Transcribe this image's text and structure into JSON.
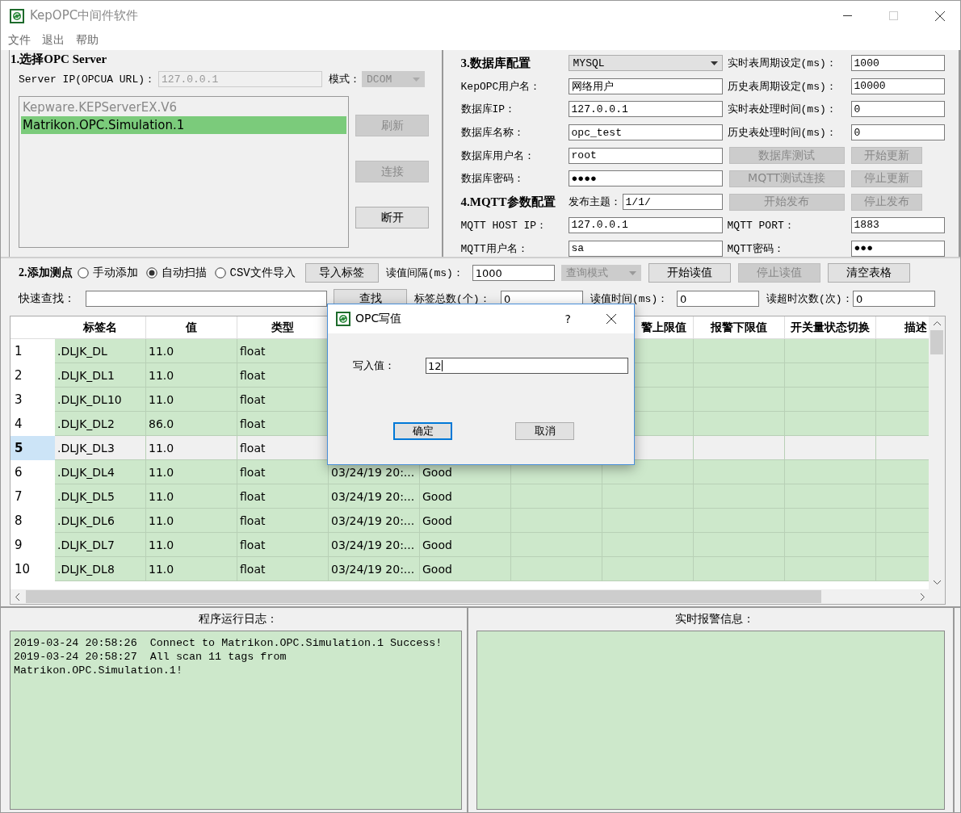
{
  "window": {
    "title": "KepOPC中间件软件"
  },
  "menu": [
    "文件",
    "退出",
    "帮助"
  ],
  "opc_server": {
    "heading": "1.选择OPC Server",
    "ip_label": "Server IP(OPCUA URL)：",
    "ip_value": "127.0.0.1",
    "ip_disabled": true,
    "mode_label": "模式：",
    "mode_value": "DCOM",
    "mode_disabled": true,
    "servers": [
      {
        "name": "Kepware.KEPServerEX.V6",
        "selected": false
      },
      {
        "name": "Matrikon.OPC.Simulation.1",
        "selected": true
      }
    ],
    "buttons": [
      {
        "label": "刷新",
        "disabled": true
      },
      {
        "label": "连接",
        "disabled": true
      },
      {
        "label": "断开",
        "disabled": false
      }
    ]
  },
  "config_rows": [
    {
      "cells": [
        {
          "kind": "heading",
          "text": "3.数据库配置"
        },
        {
          "kind": "select",
          "value": "MYSQL"
        },
        {
          "kind": "label",
          "text": "实时表周期设定(ms)："
        },
        {
          "kind": "field",
          "value": "1000"
        }
      ]
    },
    {
      "cells": [
        {
          "kind": "label",
          "text": "KepOPC用户名："
        },
        {
          "kind": "field",
          "value": "网络用户"
        },
        {
          "kind": "label",
          "text": "历史表周期设定(ms)："
        },
        {
          "kind": "field",
          "value": "10000"
        }
      ]
    },
    {
      "cells": [
        {
          "kind": "label",
          "text": "数据库IP："
        },
        {
          "kind": "field",
          "value": "127.0.0.1"
        },
        {
          "kind": "label",
          "text": "实时表处理时间(ms)："
        },
        {
          "kind": "field",
          "value": "0"
        }
      ]
    },
    {
      "cells": [
        {
          "kind": "label",
          "text": "数据库名称："
        },
        {
          "kind": "field",
          "value": "opc_test"
        },
        {
          "kind": "label",
          "text": "历史表处理时间(ms)："
        },
        {
          "kind": "field",
          "value": "0"
        }
      ]
    },
    {
      "cells": [
        {
          "kind": "label",
          "text": "数据库用户名："
        },
        {
          "kind": "field",
          "value": "root"
        },
        {
          "kind": "button",
          "text": "数据库测试",
          "disabled": true
        },
        {
          "kind": "button",
          "text": "开始更新",
          "disabled": true
        }
      ]
    },
    {
      "cells": [
        {
          "kind": "label",
          "text": "数据库密码："
        },
        {
          "kind": "field",
          "value": "●●●●"
        },
        {
          "kind": "button",
          "text": "MQTT测试连接",
          "disabled": true
        },
        {
          "kind": "button",
          "text": "停止更新",
          "disabled": true
        }
      ]
    },
    {
      "cells": [
        {
          "kind": "heading",
          "text": "4.MQTT参数配置"
        },
        {
          "kind": "labeled_field",
          "label": "发布主题：",
          "value": "1/1/"
        },
        {
          "kind": "button",
          "text": "开始发布",
          "disabled": true
        },
        {
          "kind": "button",
          "text": "停止发布",
          "disabled": true
        }
      ]
    },
    {
      "cells": [
        {
          "kind": "label",
          "text": "MQTT HOST IP："
        },
        {
          "kind": "field",
          "value": "127.0.0.1"
        },
        {
          "kind": "label",
          "text": "MQTT PORT："
        },
        {
          "kind": "field",
          "value": "1883"
        }
      ]
    },
    {
      "cells": [
        {
          "kind": "label",
          "text": "MQTT用户名："
        },
        {
          "kind": "field",
          "value": "sa"
        },
        {
          "kind": "label",
          "text": "MQTT密码："
        },
        {
          "kind": "field",
          "value": "●●●"
        }
      ]
    }
  ],
  "points": {
    "heading": "2.添加测点",
    "modes": [
      {
        "label": "手动添加",
        "selected": false
      },
      {
        "label": "自动扫描",
        "selected": true
      },
      {
        "label": "CSV文件导入",
        "selected": false
      }
    ],
    "import_button": "导入标签",
    "interval_label": "读值间隔(ms)：",
    "interval_value": "1000",
    "query_mode": {
      "value": "查询模式",
      "disabled": true
    },
    "buttons": [
      {
        "label": "开始读值",
        "disabled": false
      },
      {
        "label": "停止读值",
        "disabled": true
      },
      {
        "label": "清空表格",
        "disabled": false
      }
    ],
    "search_label": "快速查找：",
    "search_button": "查找",
    "stats": [
      {
        "label": "标签总数(个)：",
        "value": "0"
      },
      {
        "label": "读值时间(ms)：",
        "value": "0"
      },
      {
        "label": "读超时次数(次)：",
        "value": "0"
      }
    ]
  },
  "table": {
    "columns": [
      "标签名",
      "值",
      "类型",
      null,
      null,
      null,
      "警上限值",
      "报警下限值",
      "开关量状态切换",
      "描述"
    ],
    "rows": [
      {
        "index": "1",
        "cells": [
          ".DLJK_DL",
          "11.0",
          "float"
        ],
        "selected": false
      },
      {
        "index": "2",
        "cells": [
          ".DLJK_DL1",
          "11.0",
          "float"
        ],
        "selected": false
      },
      {
        "index": "3",
        "cells": [
          ".DLJK_DL10",
          "11.0",
          "float"
        ],
        "selected": false
      },
      {
        "index": "4",
        "cells": [
          ".DLJK_DL2",
          "86.0",
          "float"
        ],
        "selected": false
      },
      {
        "index": "5",
        "cells": [
          ".DLJK_DL3",
          "11.0",
          "float"
        ],
        "selected": true
      },
      {
        "index": "6",
        "cells": [
          ".DLJK_DL4",
          "11.0",
          "float",
          "03/24/19 20:...",
          "Good"
        ],
        "selected": false
      },
      {
        "index": "7",
        "cells": [
          ".DLJK_DL5",
          "11.0",
          "float",
          "03/24/19 20:...",
          "Good"
        ],
        "selected": false
      },
      {
        "index": "8",
        "cells": [
          ".DLJK_DL6",
          "11.0",
          "float",
          "03/24/19 20:...",
          "Good"
        ],
        "selected": false
      },
      {
        "index": "9",
        "cells": [
          ".DLJK_DL7",
          "11.0",
          "float",
          "03/24/19 20:...",
          "Good"
        ],
        "selected": false
      },
      {
        "index": "10",
        "cells": [
          ".DLJK_DL8",
          "11.0",
          "float",
          "03/24/19 20:...",
          "Good"
        ],
        "selected": false
      }
    ]
  },
  "log": {
    "title": "程序运行日志：",
    "entries": [
      "2019-03-24 20:58:26  Connect to Matrikon.OPC.Simulation.1 Success!",
      "2019-03-24 20:58:27  All scan 11 tags from Matrikon.OPC.Simulation.1!"
    ]
  },
  "alarms": {
    "title": "实时报警信息："
  },
  "dialog": {
    "title": "OPC写值",
    "help": "?",
    "field_label": "写入值：",
    "field_value": "12",
    "buttons": [
      {
        "label": "确定",
        "default": true
      },
      {
        "label": "取消",
        "default": false
      }
    ]
  }
}
